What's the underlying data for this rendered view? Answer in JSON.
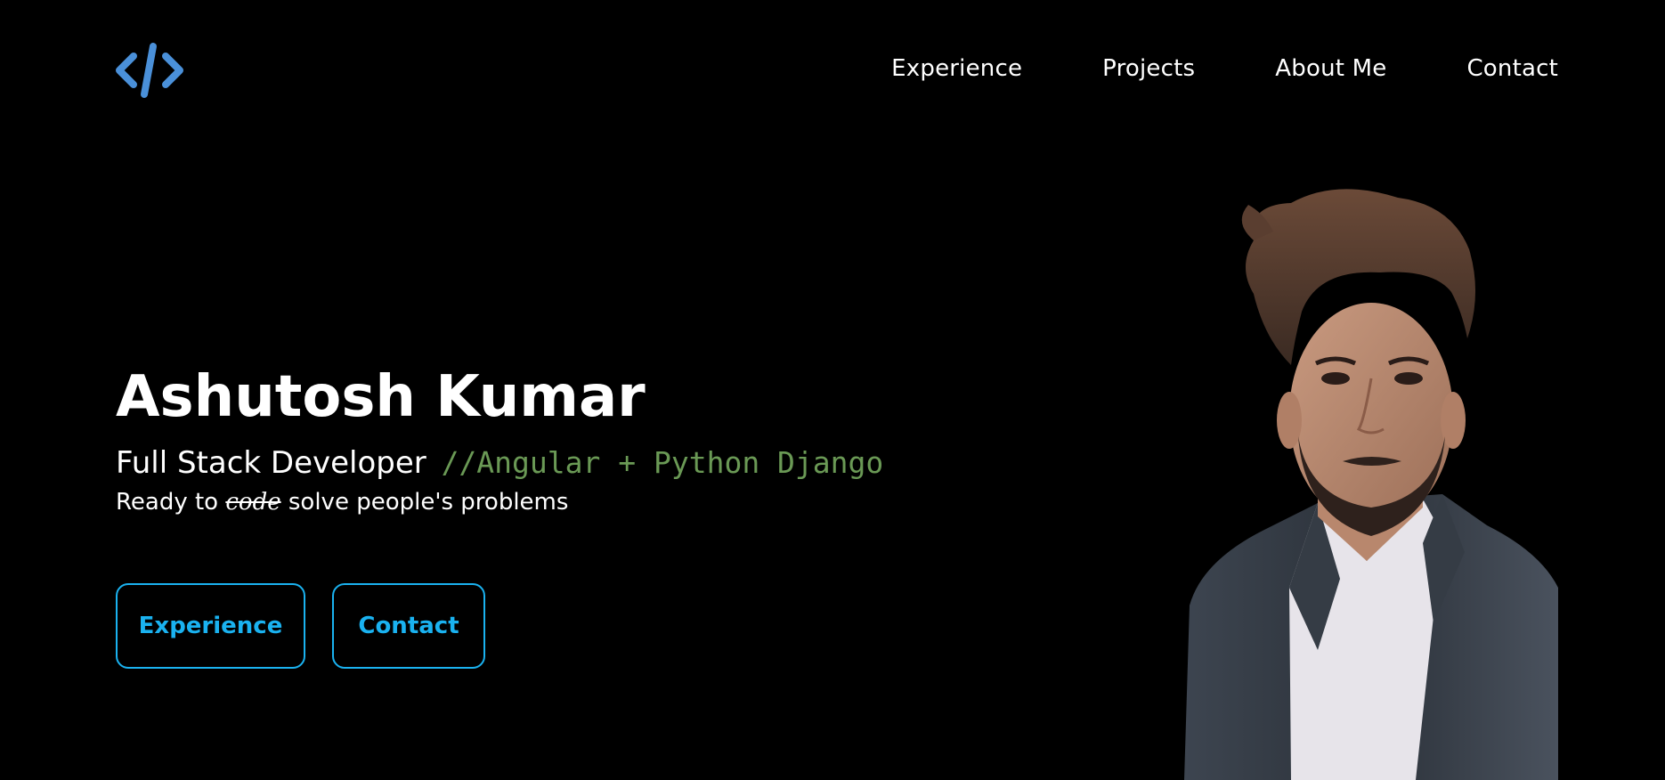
{
  "nav": {
    "logo_icon": "code-brackets-icon",
    "links": [
      {
        "label": "Experience"
      },
      {
        "label": "Projects"
      },
      {
        "label": "About Me"
      },
      {
        "label": "Contact"
      }
    ]
  },
  "hero": {
    "name": "Ashutosh Kumar",
    "role_title": "Full Stack Developer",
    "role_comment": "//Angular + Python Django",
    "tagline_prefix": "Ready to",
    "tagline_strike": "code",
    "tagline_suffix": "solve people's problems"
  },
  "cta": {
    "experience_label": "Experience",
    "contact_label": "Contact"
  },
  "colors": {
    "background": "#000000",
    "accent": "#1ab2f0",
    "logo": "#4a90d9",
    "comment": "#6a9955"
  }
}
